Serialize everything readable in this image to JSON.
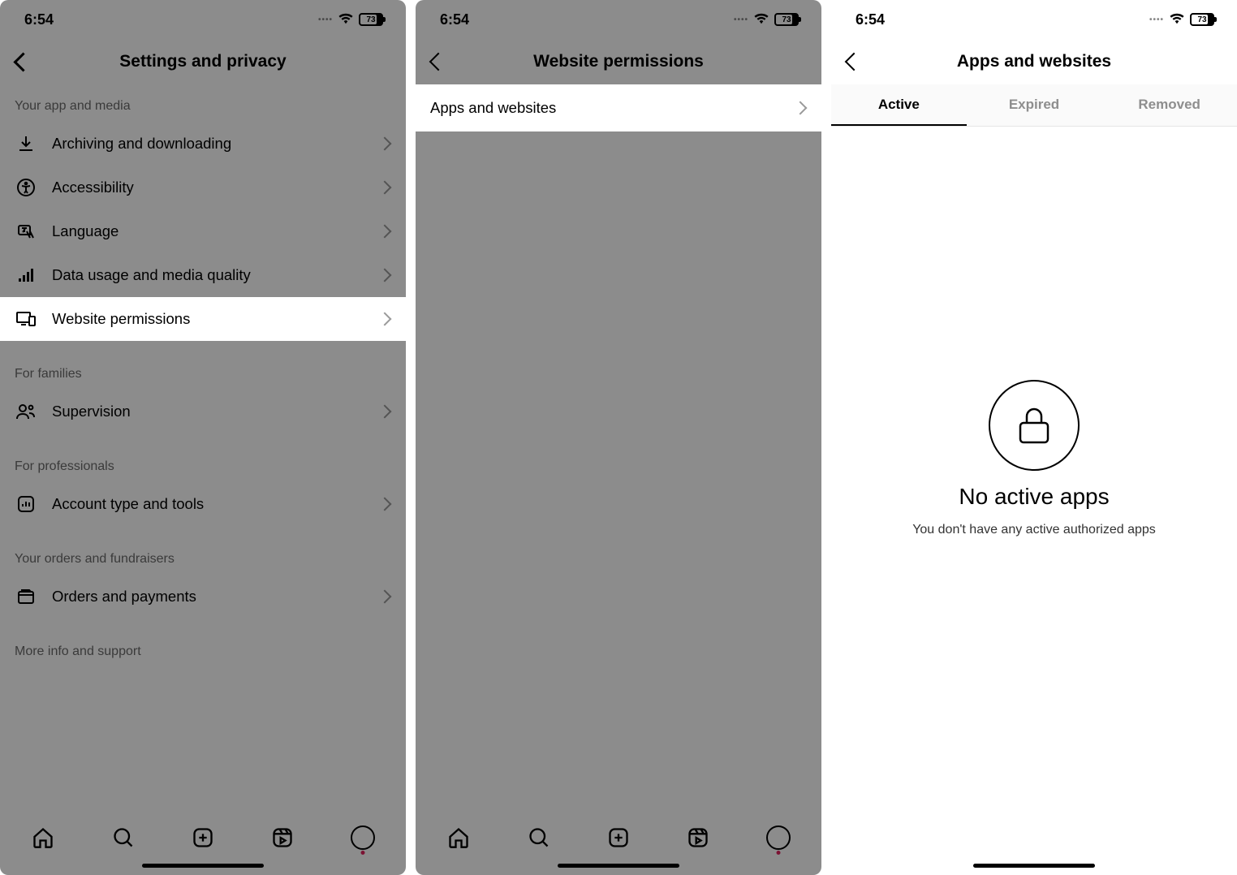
{
  "status": {
    "time": "6:54",
    "battery": "73"
  },
  "p1": {
    "title": "Settings and privacy",
    "sec_app_media": "Your app and media",
    "items_app_media": {
      "archiving": "Archiving and downloading",
      "accessibility": "Accessibility",
      "language": "Language",
      "data_usage": "Data usage and media quality",
      "website_permissions": "Website permissions"
    },
    "sec_families": "For families",
    "items_families": {
      "supervision": "Supervision"
    },
    "sec_pro": "For professionals",
    "items_pro": {
      "account_tools": "Account type and tools"
    },
    "sec_orders": "Your orders and fundraisers",
    "items_orders": {
      "orders_payments": "Orders and payments"
    },
    "sec_more": "More info and support"
  },
  "p2": {
    "title": "Website permissions",
    "item_apps_sites": "Apps and websites"
  },
  "p3": {
    "title": "Apps and websites",
    "tabs": {
      "active": "Active",
      "expired": "Expired",
      "removed": "Removed"
    },
    "empty_title": "No active apps",
    "empty_sub": "You don't have any active authorized apps"
  }
}
